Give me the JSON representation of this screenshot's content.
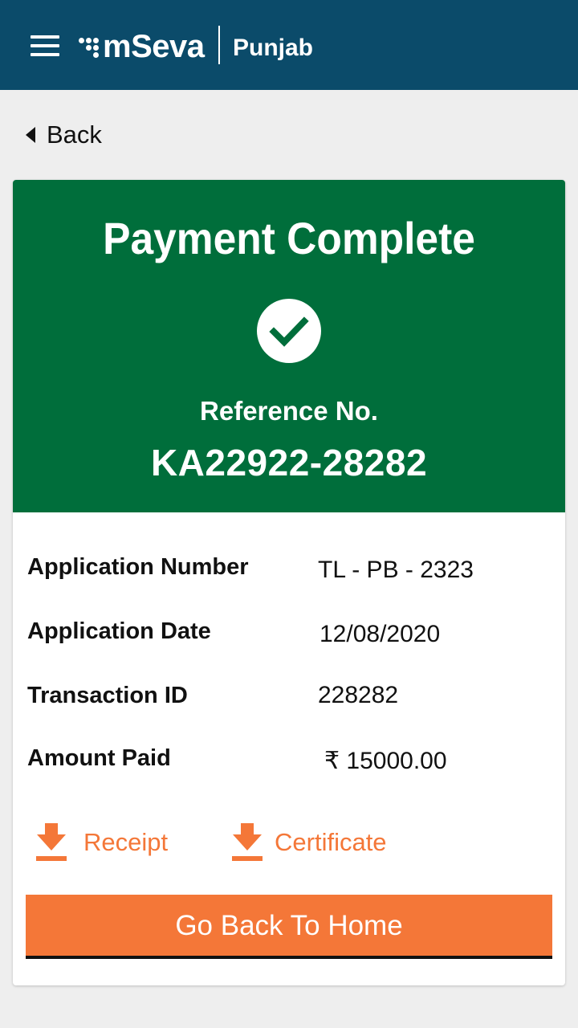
{
  "header": {
    "app_name": "mSeva",
    "state": "Punjab",
    "menu_icon": "hamburger-menu-icon",
    "bg_color": "#0b4b6a"
  },
  "nav": {
    "back_label": "Back",
    "back_icon": "caret-left-icon"
  },
  "banner": {
    "title": "Payment Complete",
    "status_icon": "check-circle-icon",
    "reference_label": "Reference No.",
    "reference_value": "KA22922-28282",
    "bg_color": "#006e3b"
  },
  "details": [
    {
      "label": "Application Number",
      "value": "TL - PB - 2323"
    },
    {
      "label": "Application Date",
      "value": "12/08/2020"
    },
    {
      "label": "Transaction ID",
      "value": "228282"
    },
    {
      "label": "Amount Paid",
      "value": "₹ 15000.00"
    }
  ],
  "downloads": {
    "receipt_label": "Receipt",
    "certificate_label": "Certificate",
    "icon": "download-icon",
    "color": "#f47738"
  },
  "actions": {
    "home_button_label": "Go Back To Home",
    "accent_color": "#f47738"
  }
}
